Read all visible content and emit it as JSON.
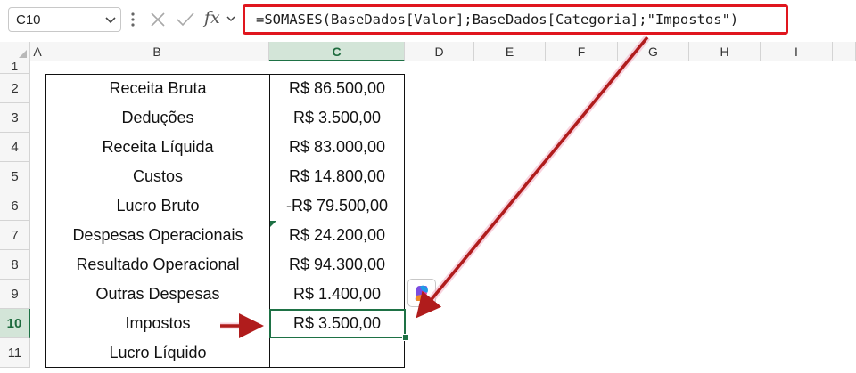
{
  "formula_bar": {
    "name_box": "C10",
    "fx_label": "fx",
    "formula": "=SOMASES(BaseDados[Valor];BaseDados[Categoria];\"Impostos\")"
  },
  "columns": [
    "A",
    "B",
    "C",
    "D",
    "E",
    "F",
    "G",
    "H",
    "I"
  ],
  "rows": [
    "1",
    "2",
    "3",
    "4",
    "5",
    "6",
    "7",
    "8",
    "9",
    "10",
    "11"
  ],
  "active_cell": {
    "column": "C",
    "row": "10"
  },
  "table": [
    {
      "label": "Receita Bruta",
      "value": "R$ 86.500,00"
    },
    {
      "label": "Deduções",
      "value": "R$ 3.500,00"
    },
    {
      "label": "Receita Líquida",
      "value": "R$ 83.000,00"
    },
    {
      "label": "Custos",
      "value": "R$ 14.800,00"
    },
    {
      "label": "Lucro Bruto",
      "value": "-R$ 79.500,00"
    },
    {
      "label": "Despesas Operacionais",
      "value": "R$ 24.200,00"
    },
    {
      "label": "Resultado Operacional",
      "value": "R$ 94.300,00"
    },
    {
      "label": "Outras Despesas",
      "value": "R$ 1.400,00"
    },
    {
      "label": "Impostos",
      "value": "R$ 3.500,00"
    },
    {
      "label": "Lucro Líquido",
      "value": ""
    }
  ],
  "colors": {
    "highlight_red": "#e0161e",
    "annotation_arrow": "#b01c1c",
    "selection_green": "#1e7145"
  },
  "icons": [
    "chevron-down-icon",
    "more-options-icon",
    "cancel-icon",
    "enter-check-icon",
    "copilot-icon"
  ]
}
